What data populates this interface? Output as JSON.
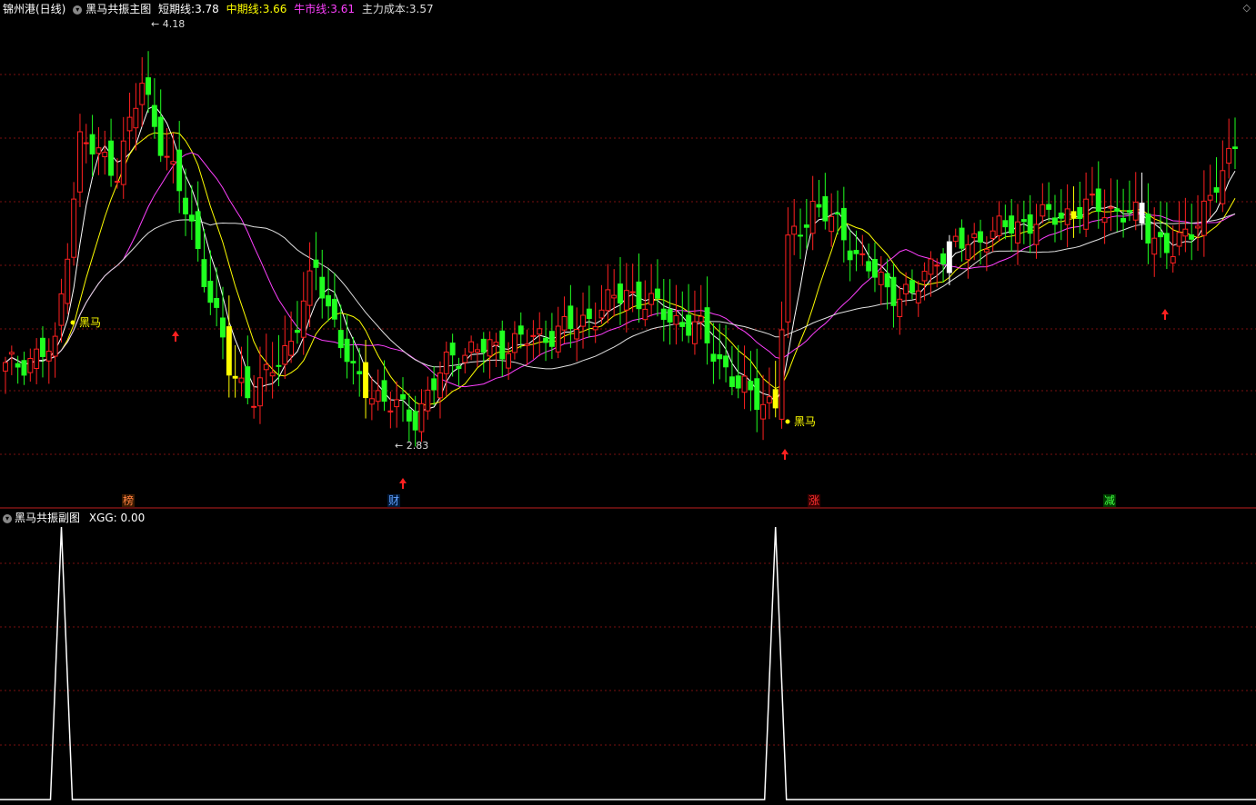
{
  "header": {
    "stock": "锦州港(日线)",
    "indicator": "黑马共振主图",
    "short_label": "短期线:",
    "short_value": "3.78",
    "mid_label": "中期线:",
    "mid_value": "3.66",
    "bull_label": "牛市线:",
    "bull_value": "3.61",
    "cost_label": "主力成本:",
    "cost_value": "3.57",
    "corner_icon": "diamond-icon"
  },
  "sub_header": {
    "indicator": "黑马共振副图",
    "xgg_label": "XGG:",
    "xgg_value": "0.00"
  },
  "colors": {
    "up": "#ff2020",
    "down": "#20ff20",
    "special": "#ffff00",
    "white_bar": "#ffffff",
    "short_line": "#ffffff",
    "mid_line": "#ffff00",
    "bull_line": "#ff40ff",
    "cost_line": "#e0e0e0",
    "grid": "#7a1010"
  },
  "chart_data": [
    {
      "type": "candlestick",
      "price_range": [
        2.62,
        4.28
      ],
      "annotations": {
        "high_label": "4.18",
        "low_label": "2.83",
        "heima_label": "黑马"
      },
      "flags": [
        {
          "text": "榜",
          "color": "#ff8040"
        },
        {
          "text": "财",
          "color": "#60a0ff"
        },
        {
          "text": "涨",
          "color": "#ff3030"
        },
        {
          "text": "减",
          "color": "#40ff40"
        }
      ]
    },
    {
      "type": "line",
      "series": [
        {
          "values_note": "spikes",
          "spikes_at_index": [
            9,
            124
          ]
        }
      ],
      "ylim": [
        0,
        1
      ]
    }
  ]
}
